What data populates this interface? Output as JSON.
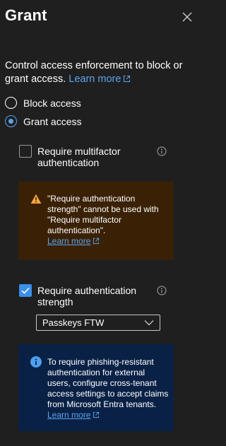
{
  "panel": {
    "title": "Grant",
    "intro_text": "Control access enforcement to block or grant access. ",
    "learn_more": "Learn more"
  },
  "radios": [
    {
      "label": "Block access",
      "checked": false
    },
    {
      "label": "Grant access",
      "checked": true
    }
  ],
  "controls": {
    "mfa": {
      "label": "Require multifactor authentication",
      "checked": false
    },
    "auth_strength": {
      "label": "Require authentication strength",
      "checked": true
    }
  },
  "warning": {
    "text": "\"Require authentication strength\" cannot be used with \"Require multifactor authentication\".",
    "link": "Learn more"
  },
  "dropdown": {
    "selected": "Passkeys FTW"
  },
  "info": {
    "text": "To require phishing-resistant authentication for external users, configure cross-tenant access settings to accept claims from Microsoft Entra tenants. ",
    "link": "Learn more"
  },
  "colors": {
    "background": "#1f1f1f",
    "accent": "#5aa4f0",
    "warning_bg": "#3a2106",
    "warning_icon": "#f7a440",
    "info_bg": "#0a2146"
  },
  "icons": [
    "close-icon",
    "external-link-icon",
    "info-icon",
    "warning-icon",
    "chevron-down-icon",
    "checkmark-icon"
  ]
}
